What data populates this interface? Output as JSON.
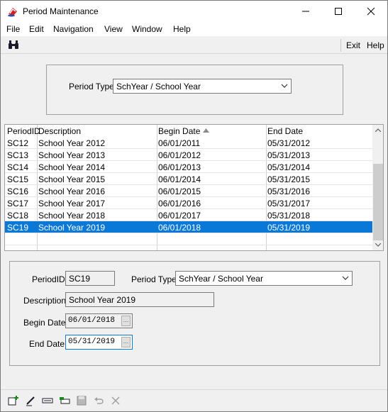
{
  "window": {
    "title": "Period Maintenance"
  },
  "menu": [
    "File",
    "Edit",
    "Navigation",
    "View",
    "Window",
    "Help"
  ],
  "toolbar": {
    "exit_label": "Exit",
    "help_label": "Help"
  },
  "filter": {
    "label": "Period Type:",
    "value": "SchYear / School Year"
  },
  "grid": {
    "columns": [
      "PeriodID",
      "Description",
      "Begin Date",
      "End Date"
    ],
    "rows": [
      [
        "SC12",
        "School Year 2012",
        "06/01/2011",
        "05/31/2012"
      ],
      [
        "SC13",
        "School Year 2013",
        "06/01/2012",
        "05/31/2013"
      ],
      [
        "SC14",
        "School Year 2014",
        "06/01/2013",
        "05/31/2014"
      ],
      [
        "SC15",
        "School Year 2015",
        "06/01/2014",
        "05/31/2015"
      ],
      [
        "SC16",
        "School Year 2016",
        "06/01/2015",
        "05/31/2016"
      ],
      [
        "SC17",
        "School Year 2017",
        "06/01/2016",
        "05/31/2017"
      ],
      [
        "SC18",
        "School Year 2018",
        "06/01/2017",
        "05/31/2018"
      ],
      [
        "SC19",
        "School Year 2019",
        "06/01/2018",
        "05/31/2019"
      ]
    ],
    "selected_row": 7
  },
  "detail": {
    "period_id_label": "PeriodID:",
    "period_id": "SC19",
    "period_type_label": "Period Type:",
    "period_type": "SchYear / School Year",
    "description_label": "Description:",
    "description": "School Year 2019",
    "begin_date_label": "Begin Date:",
    "begin_date": "06/01/2018",
    "end_date_label": "End Date:",
    "end_date": "05/31/2019",
    "date_button": "..."
  },
  "colors": {
    "selection": "#0a78d7",
    "border": "#a0a0a0"
  }
}
